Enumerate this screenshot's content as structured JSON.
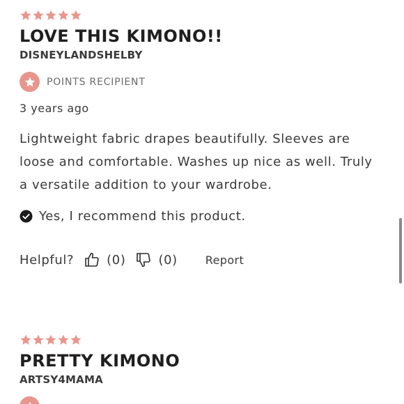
{
  "colors": {
    "star": "#e8968d",
    "badge": "#e8968d",
    "text": "#2b2b2b",
    "muted": "#6b6b6b"
  },
  "reviews": [
    {
      "rating": 5,
      "title": "LOVE THIS KIMONO!!",
      "author": "DISNEYLANDSHELBY",
      "badge_label": "POINTS RECIPIENT",
      "badge_icon": "star-icon",
      "time": "3 years ago",
      "body": "Lightweight fabric drapes beautifully. Sleeves are loose and comfortable. Washes up nice as well. Truly a versatile addition to your wardrobe.",
      "recommend": "Yes, I recommend this product.",
      "helpful_label": "Helpful?",
      "helpful_yes_count": "(0)",
      "helpful_no_count": "(0)",
      "report_label": "Report"
    },
    {
      "rating": 5,
      "title": "PRETTY KIMONO",
      "author": "ARTSY4MAMA",
      "badge_icon": "star-icon"
    }
  ]
}
